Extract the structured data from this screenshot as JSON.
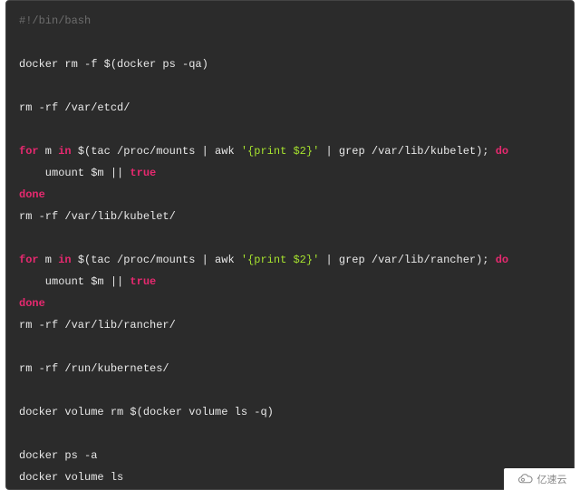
{
  "code": {
    "shebang": "#!/bin/bash",
    "blank": "",
    "l_docker_rm": "docker rm -f $(docker ps -qa)",
    "l_rm_etcd": "rm -rf /var/etcd/",
    "kw_for": "for",
    "kw_in": "in",
    "kw_do": "do",
    "kw_done": "done",
    "kw_true": "true",
    "for1_var": " m ",
    "for1_iter_a": " $(tac /proc/mounts | awk ",
    "awk_str": "'{print $2}'",
    "for1_iter_b": " | grep /var/lib/kubelet); ",
    "for_body_a": "    umount $m || ",
    "l_rm_kubelet": "rm -rf /var/lib/kubelet/",
    "for2_iter_b": " | grep /var/lib/rancher); ",
    "l_rm_rancher": "rm -rf /var/lib/rancher/",
    "l_rm_k8s": "rm -rf /run/kubernetes/",
    "l_vol_rm": "docker volume rm $(docker volume ls -q)",
    "l_ps_a": "docker ps -a",
    "l_vol_ls": "docker volume ls"
  },
  "watermark": {
    "text": "亿速云"
  }
}
